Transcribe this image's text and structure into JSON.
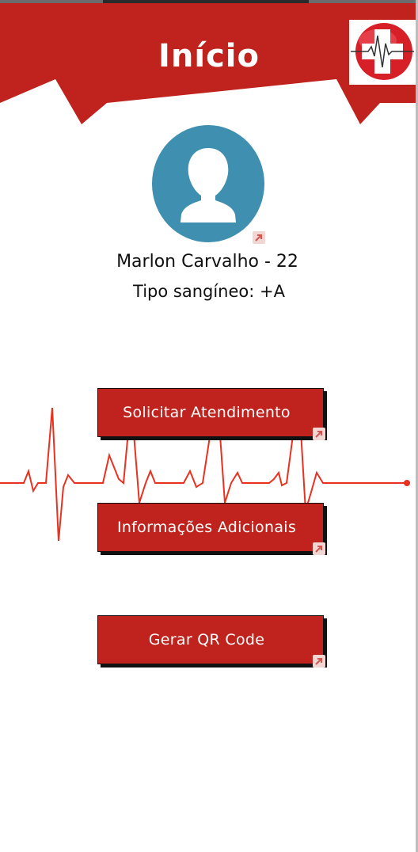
{
  "header": {
    "title": "Início",
    "background_color": "#c0231d",
    "logo_icon": "medical-cross-heartbeat-icon"
  },
  "profile": {
    "avatar_icon": "user-avatar-icon",
    "avatar_color": "#3f8fb0",
    "name_age": "Marlon Carvalho - 22",
    "blood_type": "Tipo sangíneo: +A"
  },
  "actions": {
    "request_care": "Solicitar Atendimento",
    "additional_info": "Informações Adicionais",
    "generate_qr": "Gerar QR Code"
  },
  "decoration": {
    "pulse_line_color": "#e8321f"
  }
}
